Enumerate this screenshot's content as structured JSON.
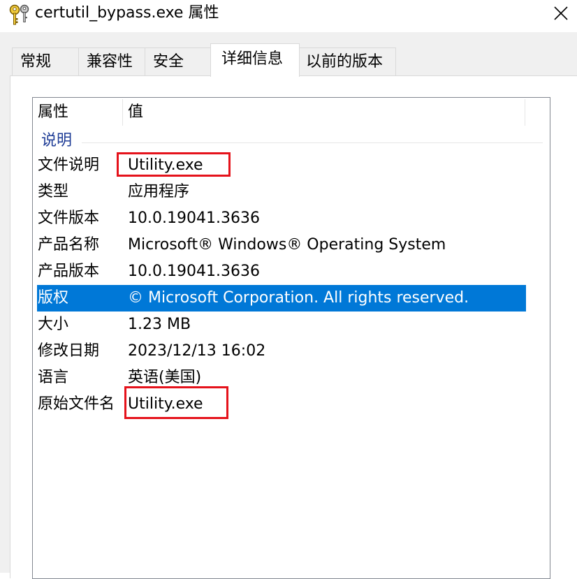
{
  "window": {
    "title": "certutil_bypass.exe 属性",
    "icon": "keys-icon",
    "close_glyph": "close-icon"
  },
  "tabs": [
    {
      "label": "常规"
    },
    {
      "label": "兼容性"
    },
    {
      "label": "安全"
    },
    {
      "label": "详细信息",
      "active": true
    },
    {
      "label": "以前的版本"
    }
  ],
  "details": {
    "columns": {
      "property": "属性",
      "value": "值"
    },
    "group": "说明",
    "rows": [
      {
        "key": "文件说明",
        "value": "Utility.exe",
        "highlighted": true
      },
      {
        "key": "类型",
        "value": "应用程序"
      },
      {
        "key": "文件版本",
        "value": "10.0.19041.3636"
      },
      {
        "key": "产品名称",
        "value": "Microsoft® Windows® Operating System"
      },
      {
        "key": "产品版本",
        "value": "10.0.19041.3636"
      },
      {
        "key": "版权",
        "value": "© Microsoft Corporation. All rights reserved.",
        "selected": true
      },
      {
        "key": "大小",
        "value": "1.23 MB"
      },
      {
        "key": "修改日期",
        "value": "2023/12/13 16:02"
      },
      {
        "key": "语言",
        "value": "英语(美国)"
      },
      {
        "key": "原始文件名",
        "value": "Utility.exe",
        "highlighted": true
      }
    ]
  },
  "colors": {
    "selection": "#0078d7",
    "group_text": "#1e3c96",
    "highlight_box": "#e5121b"
  }
}
